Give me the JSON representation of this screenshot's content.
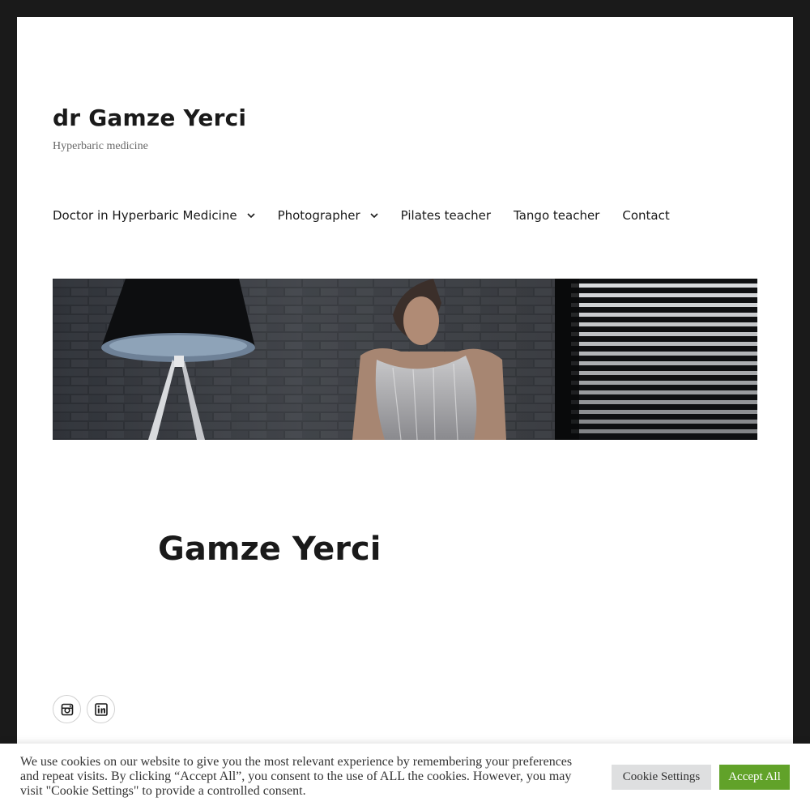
{
  "site": {
    "title": "dr Gamze Yerci",
    "description": "Hyperbaric medicine"
  },
  "nav": {
    "items": [
      {
        "label": "Doctor in Hyperbaric Medicine",
        "has_submenu": true
      },
      {
        "label": "Photographer",
        "has_submenu": true
      },
      {
        "label": "Pilates teacher",
        "has_submenu": false
      },
      {
        "label": "Tango teacher",
        "has_submenu": false
      },
      {
        "label": "Contact",
        "has_submenu": false
      }
    ]
  },
  "entry": {
    "title": "Gamze Yerci"
  },
  "social": {
    "links": [
      {
        "icon": "instagram-icon"
      },
      {
        "icon": "linkedin-icon"
      }
    ]
  },
  "cookie": {
    "text": "We use cookies on our website to give you the most relevant experience by remembering your preferences and repeat visits. By clicking “Accept All”, you consent to the use of ALL the cookies. However, you may visit \"Cookie Settings\" to provide a controlled consent.",
    "settings_label": "Cookie Settings",
    "accept_label": "Accept All"
  },
  "colors": {
    "page_background": "#1a1a1a",
    "content_background": "#ffffff",
    "text": "#1a1a1a",
    "accept_button": "#61a229",
    "settings_button": "#dedfe0"
  }
}
